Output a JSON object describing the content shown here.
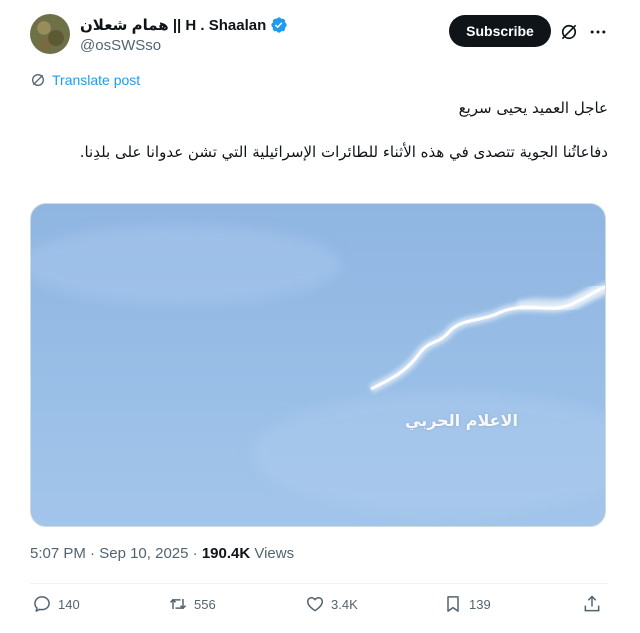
{
  "author": {
    "display_name": "همام شعلان || H . Shaalan",
    "handle": "@osSWSso",
    "verified": true
  },
  "actions_top": {
    "subscribe_label": "Subscribe",
    "grok_icon": "grok-icon",
    "more_icon": "more-icon"
  },
  "translate": {
    "label": "Translate post"
  },
  "post": {
    "line1": "عاجل العميد يحيى سريع",
    "line2": "دفاعاتُنا الجوية تتصدى في هذه الأثناء للطائرات الإسرائيلية التي تشن عدوانا على بلدِنا."
  },
  "media": {
    "watermark": "الاعلام الحربي",
    "sky_color": "#97bde6"
  },
  "meta": {
    "time": "5:07 PM",
    "date": "Sep 10, 2025",
    "views_count": "190.4K",
    "views_label": "Views"
  },
  "engagement": {
    "replies": "140",
    "reposts": "556",
    "likes": "3.4K",
    "bookmarks": "139"
  },
  "colors": {
    "accent": "#1d9bf0",
    "text": "#0f1419",
    "muted": "#536471"
  }
}
